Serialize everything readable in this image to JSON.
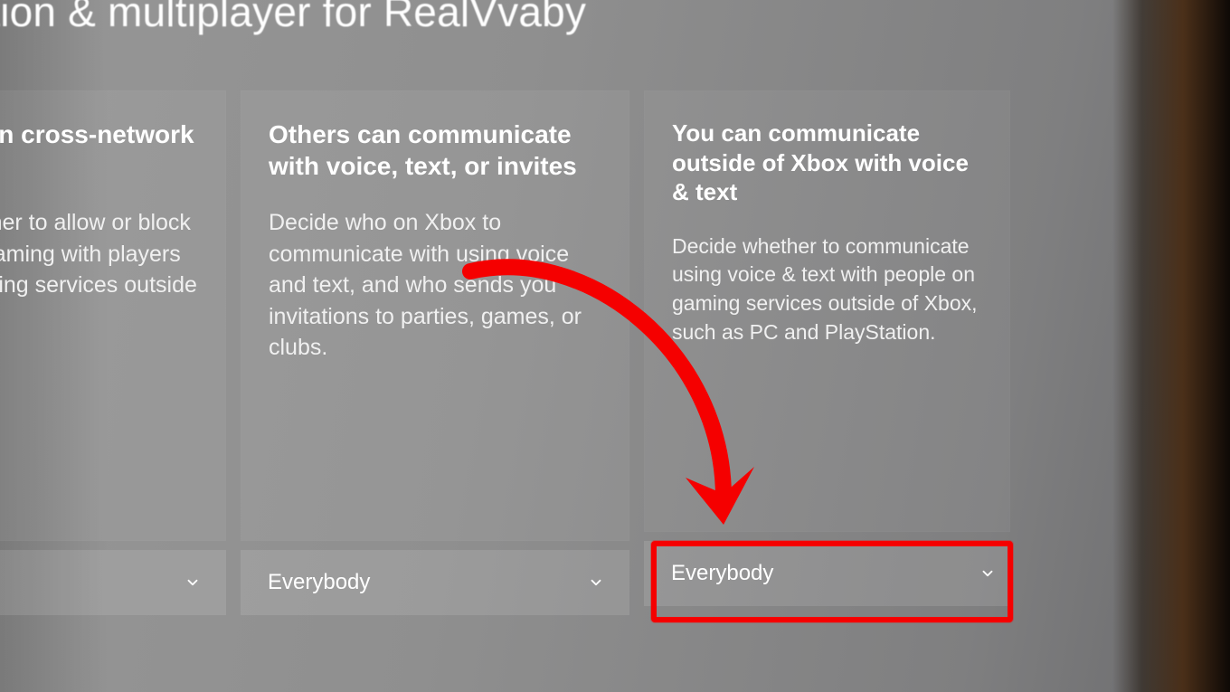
{
  "header": {
    "title": "Communication & multiplayer for RealVvaby"
  },
  "cards": [
    {
      "title": "You can join cross-network play",
      "description": "Decide whether to allow or block multiplayer gaming with players on other gaming services outside of Xbox.",
      "selected": ""
    },
    {
      "title": "Others can communicate with voice, text, or invites",
      "description": "Decide who on Xbox to communicate with using voice and text, and who sends you invitations to parties, games, or clubs.",
      "selected": "Everybody"
    },
    {
      "title": "You can communicate outside of Xbox with voice & text",
      "description": "Decide whether to communicate using voice & text with people on gaming services outside of Xbox, such as PC and PlayStation.",
      "selected": "Everybody"
    }
  ],
  "annotation": {
    "highlight_target": "cards.2.dropdown",
    "color": "#f50000"
  }
}
